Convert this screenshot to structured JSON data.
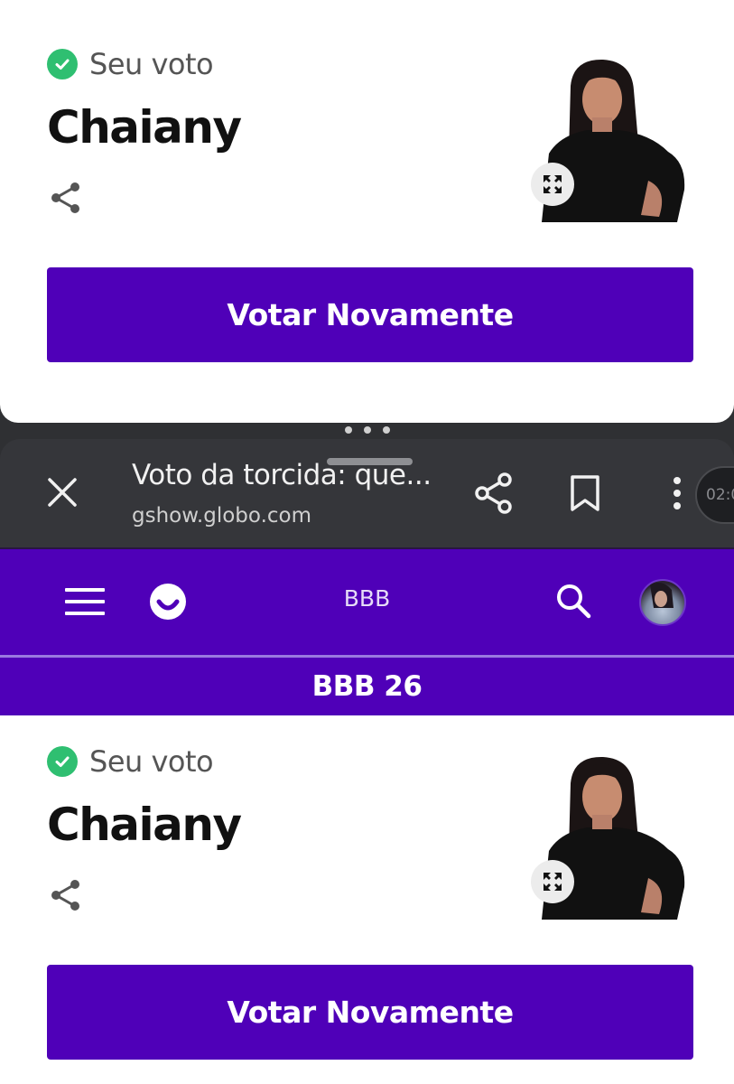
{
  "vote_card": {
    "status_label": "Seu voto",
    "candidate_name": "Chaiany",
    "vote_again_label": "Votar Novamente"
  },
  "custom_tab": {
    "title": "Voto da torcida: que...",
    "url": "gshow.globo.com",
    "timer": "02:0"
  },
  "site_header": {
    "title": "BBB",
    "section_title": "BBB 26"
  },
  "colors": {
    "brand_purple": "#4f00b8",
    "check_green": "#2fbf71",
    "toolbar_dark": "#35363a"
  },
  "icons": [
    "check-circle-icon",
    "share-icon",
    "expand-icon",
    "close-icon",
    "bookmark-icon",
    "more-vert-icon",
    "menu-icon",
    "globo-logo-icon",
    "search-icon"
  ]
}
